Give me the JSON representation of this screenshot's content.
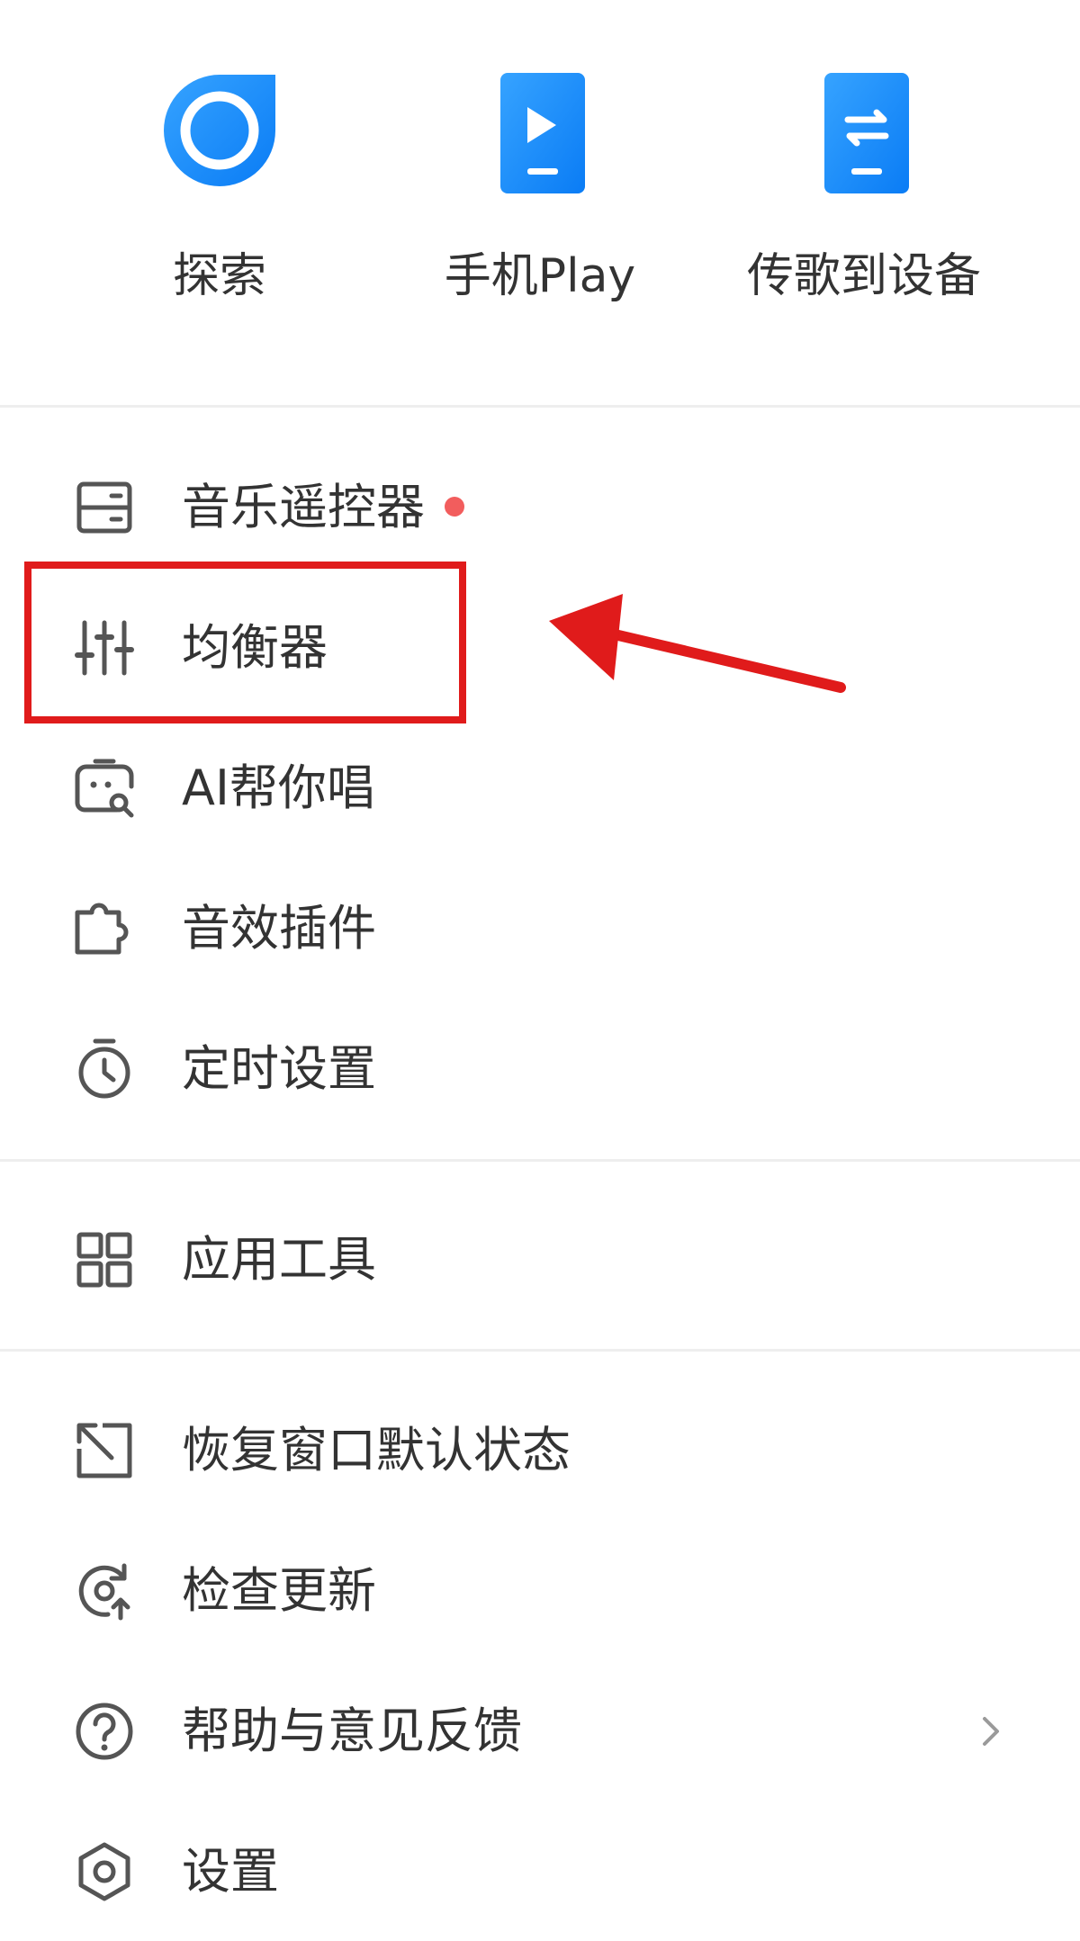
{
  "quick_actions": [
    {
      "label": "探索",
      "icon": "explore-icon"
    },
    {
      "label": "手机Play",
      "icon": "phone-play-icon"
    },
    {
      "label": "传歌到设备",
      "icon": "transfer-to-device-icon"
    }
  ],
  "menu": {
    "remote_control": {
      "label": "音乐遥控器",
      "icon": "remote-icon",
      "has_badge": true
    },
    "equalizer": {
      "label": "均衡器",
      "icon": "equalizer-icon"
    },
    "ai_sing": {
      "label": "AI帮你唱",
      "icon": "ai-sing-icon"
    },
    "sound_plugin": {
      "label": "音效插件",
      "icon": "puzzle-icon"
    },
    "timer": {
      "label": "定时设置",
      "icon": "timer-icon"
    },
    "app_tools": {
      "label": "应用工具",
      "icon": "grid-icon"
    },
    "restore_window": {
      "label": "恢复窗口默认状态",
      "icon": "restore-window-icon"
    },
    "check_update": {
      "label": "检查更新",
      "icon": "refresh-icon"
    },
    "help_feedback": {
      "label": "帮助与意见反馈",
      "icon": "help-icon",
      "has_submenu": true
    },
    "settings": {
      "label": "设置",
      "icon": "settings-icon"
    }
  },
  "colors": {
    "accent_blue": "#1a8cff",
    "badge_red": "#f25d5d",
    "annotation_red": "#e01b1b",
    "text": "#333333",
    "icon": "#555555",
    "divider": "#eeeeee"
  }
}
